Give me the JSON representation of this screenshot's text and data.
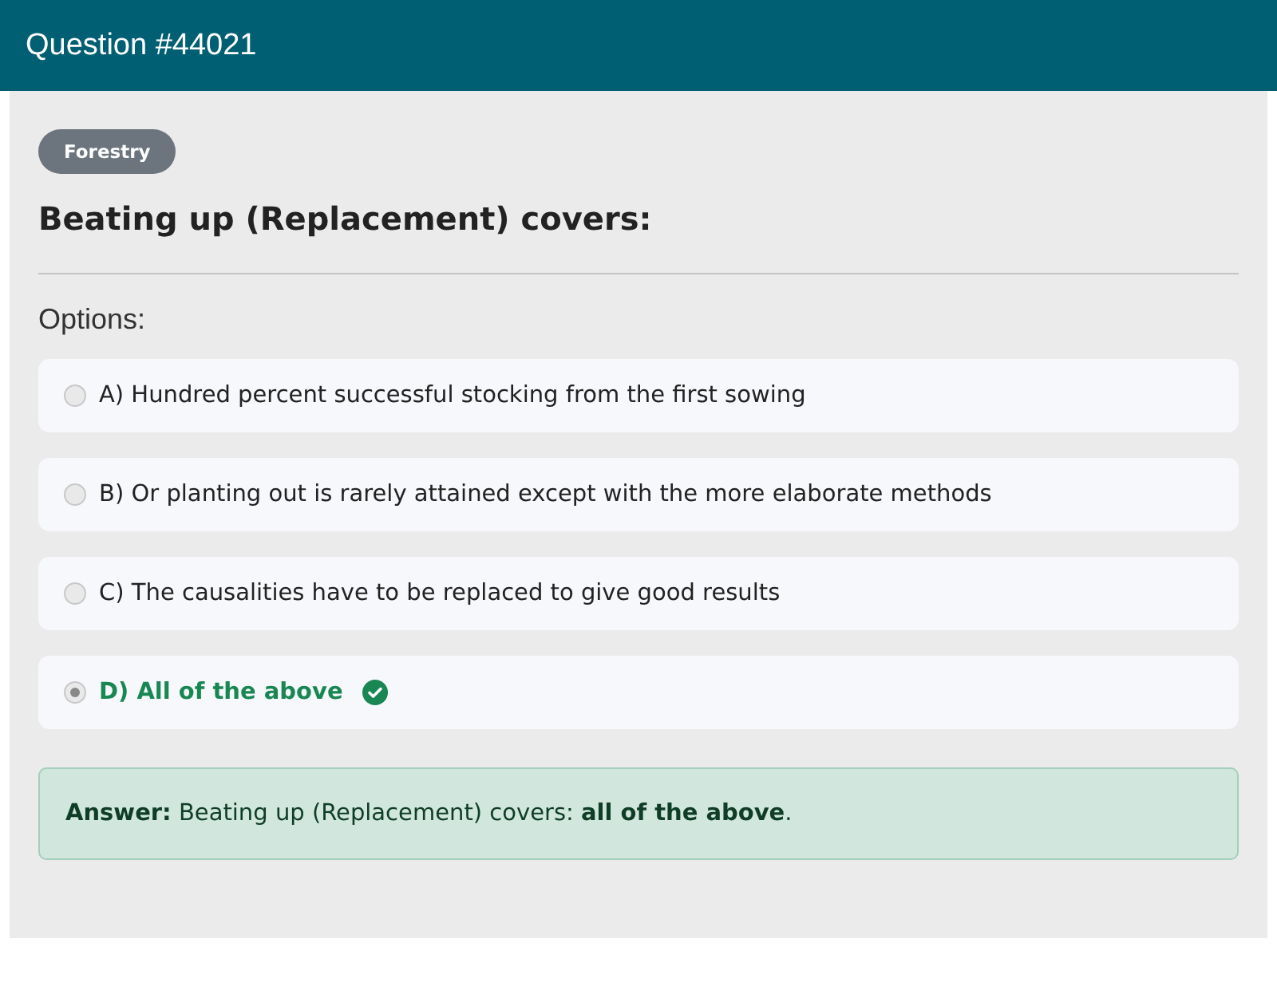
{
  "header": {
    "title": "Question #44021"
  },
  "question": {
    "category": "Forestry",
    "text": "Beating up (Replacement) covers:",
    "options_label": "Options:",
    "options": [
      {
        "text": "A) Hundred percent successful stocking from the first sowing",
        "selected": false,
        "correct": false
      },
      {
        "text": "B) Or planting out is rarely attained except with the more elaborate methods",
        "selected": false,
        "correct": false
      },
      {
        "text": "C) The causalities have to be replaced to give good results",
        "selected": false,
        "correct": false
      },
      {
        "text": "D) All of the above",
        "selected": true,
        "correct": true
      }
    ],
    "answer": "**Answer:** Beating up (Replacement) covers: **all of the above**."
  }
}
